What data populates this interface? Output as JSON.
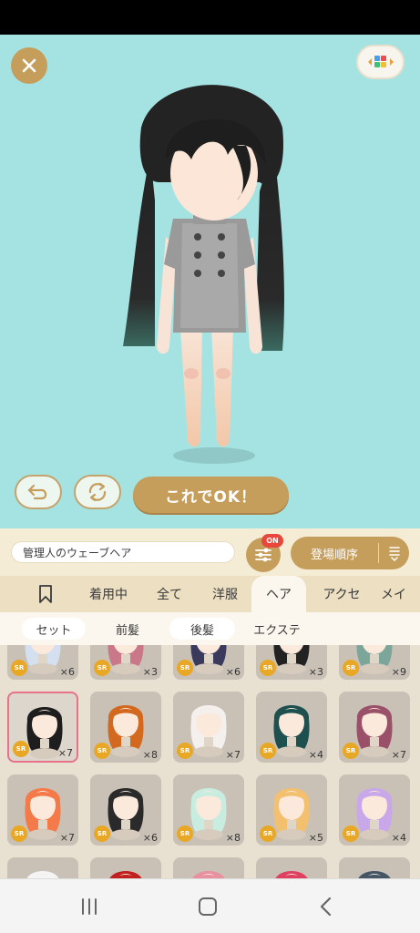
{
  "header": {
    "close_icon": "close-icon",
    "grid_icon": "grid-icon"
  },
  "actions": {
    "undo_icon": "undo-icon",
    "rotate_icon": "rotate-icon",
    "ok_label": "これでOK！"
  },
  "item_name": "管理人のウェーブヘア",
  "filter": {
    "badge": "ON",
    "icon": "sliders-icon"
  },
  "sort": {
    "label": "登場順序",
    "icon": "sort-icon"
  },
  "tabs": [
    {
      "label": ""
    },
    {
      "label": "着用中"
    },
    {
      "label": "全て"
    },
    {
      "label": "洋服"
    },
    {
      "label": "ヘア"
    },
    {
      "label": "アクセ"
    },
    {
      "label": "メイ"
    }
  ],
  "subtabs": [
    {
      "label": "セット"
    },
    {
      "label": "前髪"
    },
    {
      "label": "後髪"
    },
    {
      "label": "エクステ"
    }
  ],
  "items": [
    {
      "rarity": "SR",
      "count": "×6",
      "hair": "#d4dff0"
    },
    {
      "rarity": "SR",
      "count": "×3",
      "hair": "#c87888"
    },
    {
      "rarity": "SR",
      "count": "×6",
      "hair": "#3a3a5c"
    },
    {
      "rarity": "SR",
      "count": "×3",
      "hair": "#222222"
    },
    {
      "rarity": "SR",
      "count": "×9",
      "hair": "#7da69a"
    },
    {
      "rarity": "SR",
      "count": "×7",
      "hair": "#1e1e1e"
    },
    {
      "rarity": "SR",
      "count": "×8",
      "hair": "#d2691e"
    },
    {
      "rarity": "SR",
      "count": "×7",
      "hair": "#f4f0ee"
    },
    {
      "rarity": "SR",
      "count": "×4",
      "hair": "#1f5050"
    },
    {
      "rarity": "SR",
      "count": "×7",
      "hair": "#9a5068"
    },
    {
      "rarity": "SR",
      "count": "×7",
      "hair": "#f47a4a"
    },
    {
      "rarity": "SR",
      "count": "×6",
      "hair": "#2a2a2a"
    },
    {
      "rarity": "SR",
      "count": "×8",
      "hair": "#c8ece0"
    },
    {
      "rarity": "SR",
      "count": "×5",
      "hair": "#f3c070"
    },
    {
      "rarity": "SR",
      "count": "×4",
      "hair": "#c8a8e8"
    },
    {
      "rarity": "",
      "count": "",
      "hair": "#f4f4f4"
    },
    {
      "rarity": "",
      "count": "",
      "hair": "#c02020"
    },
    {
      "rarity": "",
      "count": "",
      "hair": "#e890a0"
    },
    {
      "rarity": "",
      "count": "",
      "hair": "#e04060"
    },
    {
      "rarity": "",
      "count": "",
      "hair": "#445566"
    }
  ],
  "colors": {
    "accent": "#c69e5c",
    "stage": "#a4e3e2",
    "badge": "#e8483c",
    "selected": "#e8728a"
  },
  "navbar": {
    "recent_icon": "recent-apps-icon",
    "home_icon": "home-icon",
    "back_icon": "back-icon"
  }
}
